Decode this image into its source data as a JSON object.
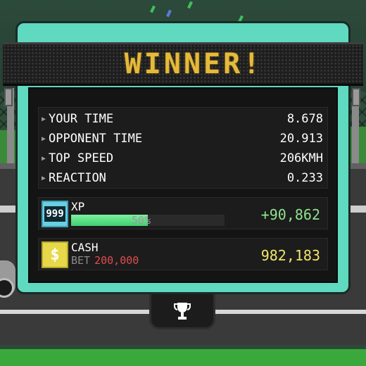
{
  "banner": {
    "title": "WINNER!"
  },
  "stats": [
    {
      "label": "YOUR TIME",
      "value": "8.678"
    },
    {
      "label": "OPPONENT TIME",
      "value": "20.913"
    },
    {
      "label": "TOP SPEED",
      "value": "206KMH"
    },
    {
      "label": "REACTION",
      "value": "0.233"
    }
  ],
  "xp": {
    "level": "999",
    "label": "XP",
    "progress_percent": 50,
    "progress_text": "50%",
    "gain": "+90,862"
  },
  "cash": {
    "icon": "dollar-icon",
    "label": "CASH",
    "bet_label": "BET",
    "bet_value": "200,000",
    "amount": "982,183"
  },
  "actions": {
    "trophy_icon": "trophy-icon"
  },
  "colors": {
    "panel_accent": "#5fd9bf",
    "banner_text": "#e5b93b",
    "xp_gain": "#8ee48e",
    "cash_amount": "#f0e66a",
    "bet_value": "#e04d4d",
    "xp_fill": "#3fcf6f"
  }
}
